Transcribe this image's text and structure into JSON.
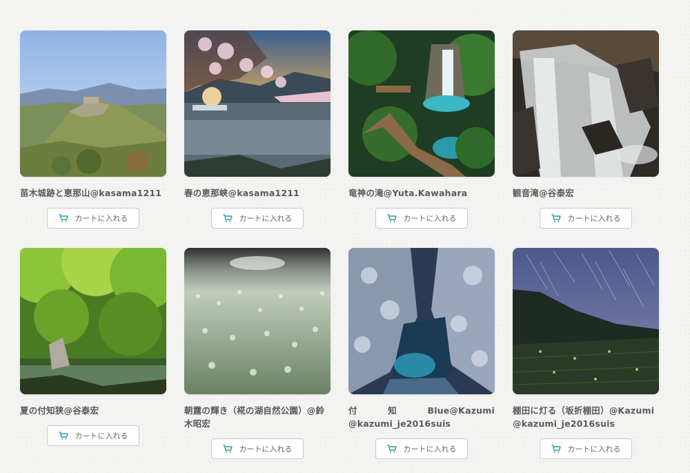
{
  "products": [
    {
      "caption": "苗木城跡と恵那山@kasama1211",
      "button": "カートに入れる"
    },
    {
      "caption": "春の恵那峡@kasama1211",
      "button": "カートに入れる"
    },
    {
      "caption": "竜神の滝@Yuta.Kawahara",
      "button": "カートに入れる"
    },
    {
      "caption": "観音滝@谷泰宏",
      "button": "カートに入れる"
    },
    {
      "caption": "夏の付知狭@谷泰宏",
      "button": "カートに入れる"
    },
    {
      "caption": "朝露の輝き（椛の湖自然公園）@鈴木昭宏",
      "button": "カートに入れる"
    },
    {
      "caption": "付　　　知　　　Blue@Kazumi @kazumi_je2016suis",
      "button": "カートに入れる"
    },
    {
      "caption": "棚田に灯る（坂折棚田）@Kazumi @kazumi_je2016suis",
      "button": "カートに入れる"
    }
  ],
  "colors": {
    "cart_icon": "#2a9aa8",
    "button_border": "#c8c8c8",
    "caption": "#5a5a5a"
  }
}
